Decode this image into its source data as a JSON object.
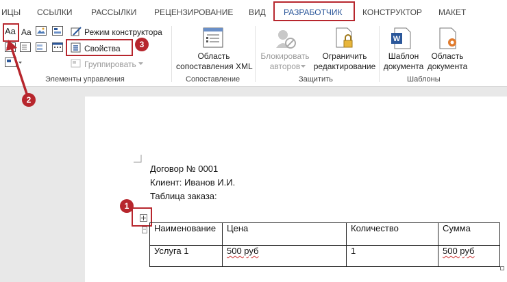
{
  "tabs": {
    "partial": "ИЦЫ",
    "mailings_refs": "ССЫЛКИ",
    "mailings": "РАССЫЛКИ",
    "review": "РЕЦЕНЗИРОВАНИЕ",
    "view": "ВИД",
    "developer": "РАЗРАБОТЧИК",
    "design": "КОНСТРУКТОР",
    "layout": "МАКЕТ"
  },
  "controls_group": {
    "rich_text_label": "Aa",
    "plain_text_label": "Aa",
    "design_mode": "Режим конструктора",
    "properties": "Свойства",
    "group": "Группировать",
    "label": "Элементы управления"
  },
  "mapping_group": {
    "xml_pane_line1": "Область",
    "xml_pane_line2": "сопоставления XML",
    "label": "Сопоставление"
  },
  "protect_group": {
    "block_authors_line1": "Блокировать",
    "block_authors_line2": "авторов",
    "restrict_line1": "Ограничить",
    "restrict_line2": "редактирование",
    "label": "Защитить"
  },
  "templates_group": {
    "template_line1": "Шаблон",
    "template_line2": "документа",
    "panel_line1": "Область",
    "panel_line2": "документа",
    "label": "Шаблоны"
  },
  "annotations": {
    "one": "1",
    "two": "2",
    "three": "3"
  },
  "document": {
    "line1": "Договор № 0001",
    "line2": "Клиент: Иванов И.И.",
    "line3": "Таблица заказа:",
    "table": {
      "headers": [
        "Наименование",
        "Цена",
        "Количество",
        "Сумма"
      ],
      "rows": [
        [
          "Услуга 1",
          "500 руб",
          "1",
          "500 руб"
        ]
      ]
    }
  },
  "colors": {
    "annotation_red": "#b7262d",
    "active_tab_blue": "#2b579a"
  }
}
